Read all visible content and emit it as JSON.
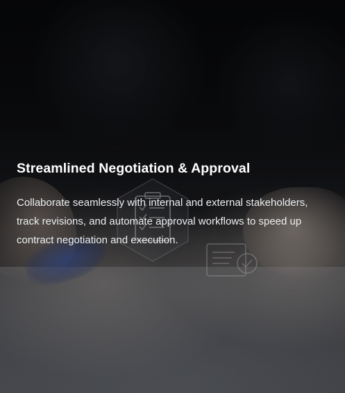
{
  "card": {
    "title": "Streamlined Negotiation & Approval",
    "description": "Collaborate seamlessly with internal and external stakeholders, track revisions, and automate approval workflows to speed up contract negotiation and execution."
  },
  "background": {
    "image_icons": [
      "clipboard-checklist-icon",
      "document-check-icon"
    ]
  }
}
